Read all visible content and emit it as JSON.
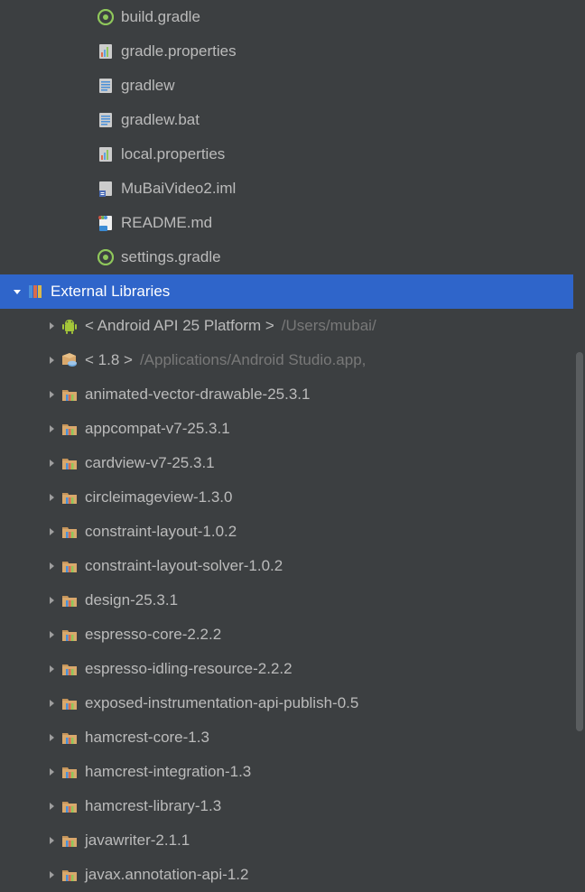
{
  "projectFiles": [
    {
      "icon": "gradle",
      "label": "build.gradle",
      "indent": 88
    },
    {
      "icon": "props",
      "label": "gradle.properties",
      "indent": 88
    },
    {
      "icon": "textfile",
      "label": "gradlew",
      "indent": 88
    },
    {
      "icon": "textfile",
      "label": "gradlew.bat",
      "indent": 88
    },
    {
      "icon": "props",
      "label": "local.properties",
      "indent": 88
    },
    {
      "icon": "iml",
      "label": "MuBaiVideo2.iml",
      "indent": 88
    },
    {
      "icon": "readme",
      "label": "README.md",
      "indent": 88
    },
    {
      "icon": "gradle",
      "label": "settings.gradle",
      "indent": 88
    }
  ],
  "externalLibraries": {
    "label": "External Libraries",
    "selected": true,
    "expanded": true,
    "indent": 10,
    "children": [
      {
        "icon": "android",
        "label": "< Android API 25 Platform >",
        "suffix": "/Users/mubai/",
        "indent": 48
      },
      {
        "icon": "jdk",
        "label": "< 1.8 >",
        "suffix": "/Applications/Android Studio.app,",
        "indent": 48
      },
      {
        "icon": "libfolder",
        "label": "animated-vector-drawable-25.3.1",
        "indent": 48
      },
      {
        "icon": "libfolder",
        "label": "appcompat-v7-25.3.1",
        "indent": 48
      },
      {
        "icon": "libfolder",
        "label": "cardview-v7-25.3.1",
        "indent": 48
      },
      {
        "icon": "libfolder",
        "label": "circleimageview-1.3.0",
        "indent": 48
      },
      {
        "icon": "libfolder",
        "label": "constraint-layout-1.0.2",
        "indent": 48
      },
      {
        "icon": "libfolder",
        "label": "constraint-layout-solver-1.0.2",
        "indent": 48
      },
      {
        "icon": "libfolder",
        "label": "design-25.3.1",
        "indent": 48
      },
      {
        "icon": "libfolder",
        "label": "espresso-core-2.2.2",
        "indent": 48
      },
      {
        "icon": "libfolder",
        "label": "espresso-idling-resource-2.2.2",
        "indent": 48
      },
      {
        "icon": "libfolder",
        "label": "exposed-instrumentation-api-publish-0.5",
        "indent": 48
      },
      {
        "icon": "libfolder",
        "label": "hamcrest-core-1.3",
        "indent": 48
      },
      {
        "icon": "libfolder",
        "label": "hamcrest-integration-1.3",
        "indent": 48
      },
      {
        "icon": "libfolder",
        "label": "hamcrest-library-1.3",
        "indent": 48
      },
      {
        "icon": "libfolder",
        "label": "javawriter-2.1.1",
        "indent": 48
      },
      {
        "icon": "libfolder",
        "label": "javax.annotation-api-1.2",
        "indent": 48
      }
    ]
  }
}
